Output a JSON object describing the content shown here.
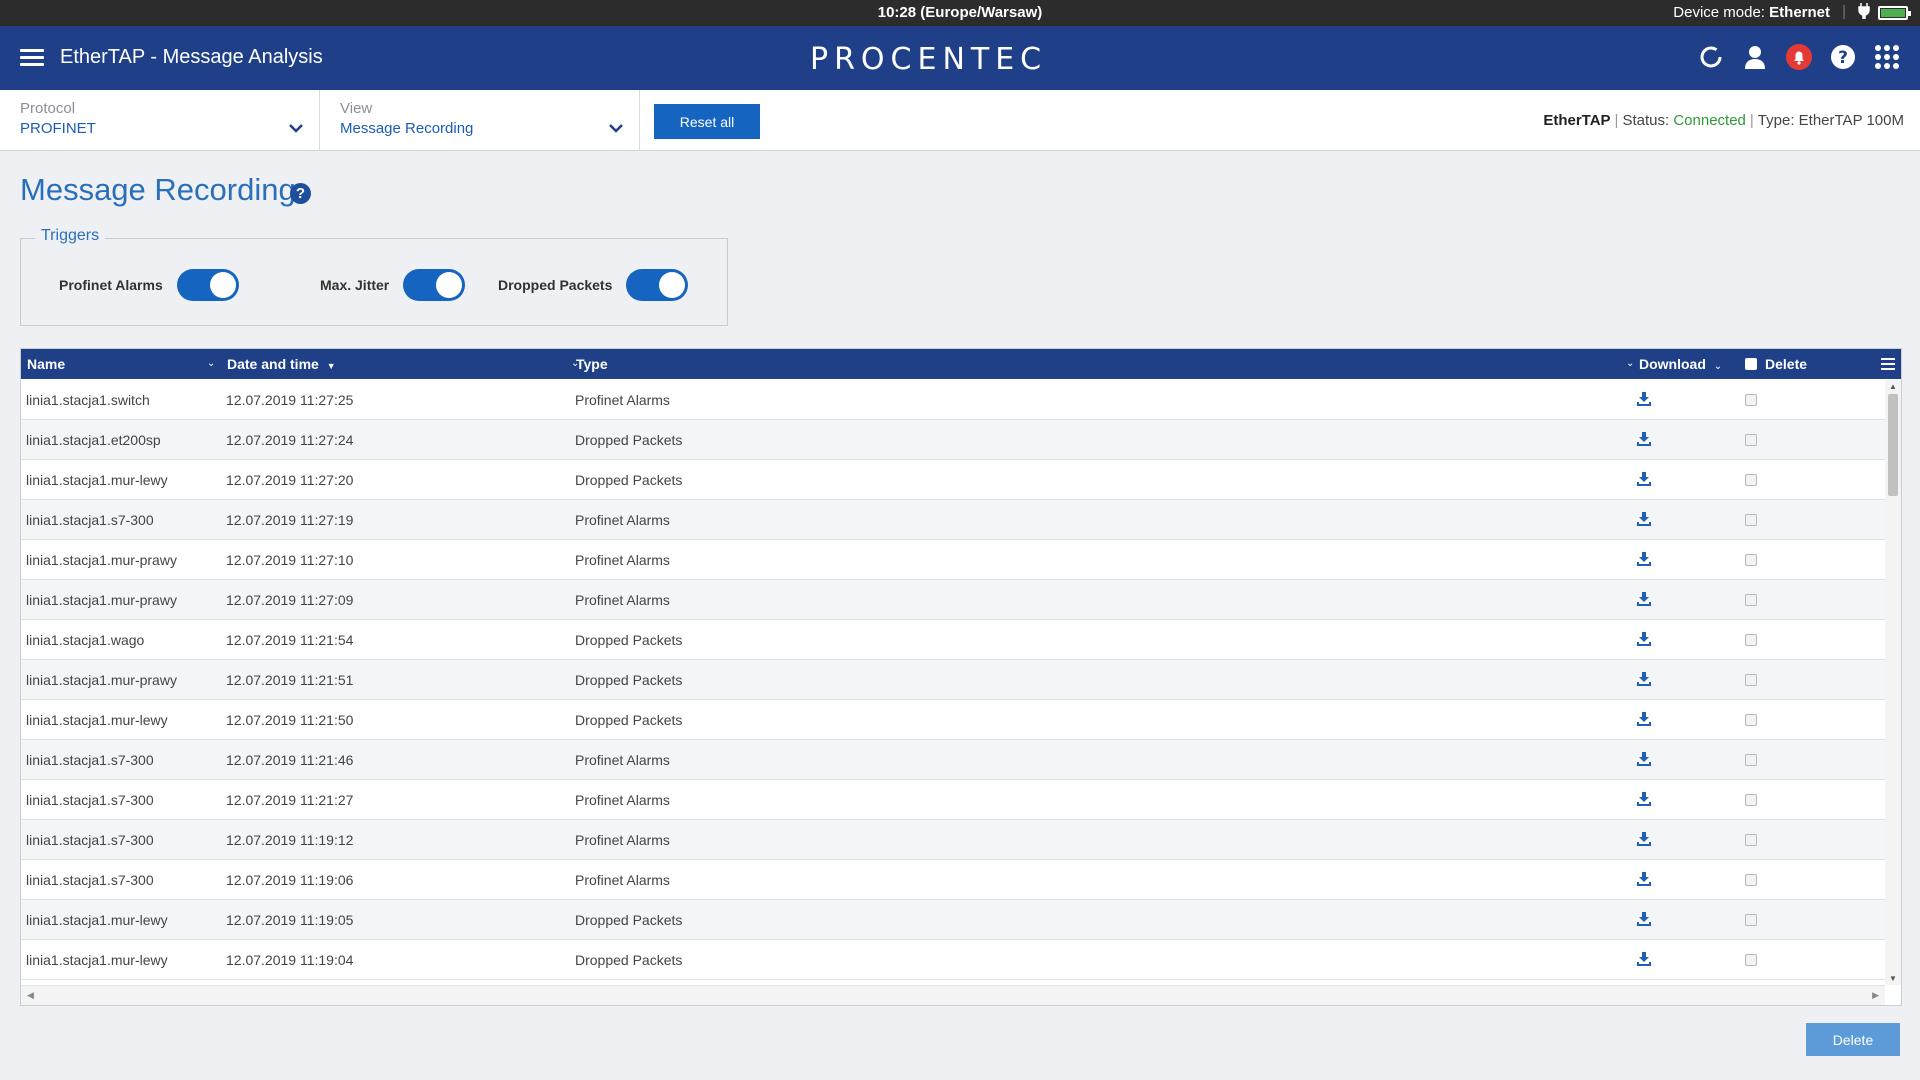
{
  "statusbar": {
    "clock": "10:28 (Europe/Warsaw)",
    "mode_label": "Device mode:",
    "mode_value": "Ethernet",
    "separator": "|"
  },
  "header": {
    "title": "EtherTAP - Message Analysis",
    "logo": "PROCENTEC",
    "icons": [
      "refresh-icon",
      "user-icon",
      "notifications-icon",
      "help-icon",
      "apps-icon"
    ],
    "alert_color": "#e53935"
  },
  "toolbar": {
    "protocol_label": "Protocol",
    "protocol_value": "PROFINET",
    "view_label": "View",
    "view_value": "Message Recording",
    "reset_label": "Reset all",
    "device_name": "EtherTAP",
    "status_label": "Status:",
    "status_value": "Connected",
    "type_label": "Type:",
    "type_value": "EtherTAP 100M",
    "separator": "|"
  },
  "page": {
    "title": "Message Recording",
    "help_glyph": "?"
  },
  "triggers": {
    "legend": "Triggers",
    "items": [
      {
        "label": "Profinet Alarms",
        "on": true
      },
      {
        "label": "Max. Jitter",
        "on": true
      },
      {
        "label": "Dropped Packets",
        "on": true
      }
    ]
  },
  "table": {
    "columns": {
      "name": "Name",
      "datetime": "Date and time",
      "type": "Type",
      "download": "Download",
      "delete": "Delete"
    },
    "rows": [
      {
        "name": "linia1.stacja1.switch",
        "datetime": "12.07.2019 11:27:25",
        "type": "Profinet Alarms"
      },
      {
        "name": "linia1.stacja1.et200sp",
        "datetime": "12.07.2019 11:27:24",
        "type": "Dropped Packets"
      },
      {
        "name": "linia1.stacja1.mur-lewy",
        "datetime": "12.07.2019 11:27:20",
        "type": "Dropped Packets"
      },
      {
        "name": "linia1.stacja1.s7-300",
        "datetime": "12.07.2019 11:27:19",
        "type": "Profinet Alarms"
      },
      {
        "name": "linia1.stacja1.mur-prawy",
        "datetime": "12.07.2019 11:27:10",
        "type": "Profinet Alarms"
      },
      {
        "name": "linia1.stacja1.mur-prawy",
        "datetime": "12.07.2019 11:27:09",
        "type": "Profinet Alarms"
      },
      {
        "name": "linia1.stacja1.wago",
        "datetime": "12.07.2019 11:21:54",
        "type": "Dropped Packets"
      },
      {
        "name": "linia1.stacja1.mur-prawy",
        "datetime": "12.07.2019 11:21:51",
        "type": "Dropped Packets"
      },
      {
        "name": "linia1.stacja1.mur-lewy",
        "datetime": "12.07.2019 11:21:50",
        "type": "Dropped Packets"
      },
      {
        "name": "linia1.stacja1.s7-300",
        "datetime": "12.07.2019 11:21:46",
        "type": "Profinet Alarms"
      },
      {
        "name": "linia1.stacja1.s7-300",
        "datetime": "12.07.2019 11:21:27",
        "type": "Profinet Alarms"
      },
      {
        "name": "linia1.stacja1.s7-300",
        "datetime": "12.07.2019 11:19:12",
        "type": "Profinet Alarms"
      },
      {
        "name": "linia1.stacja1.s7-300",
        "datetime": "12.07.2019 11:19:06",
        "type": "Profinet Alarms"
      },
      {
        "name": "linia1.stacja1.mur-lewy",
        "datetime": "12.07.2019 11:19:05",
        "type": "Dropped Packets"
      },
      {
        "name": "linia1.stacja1.mur-lewy",
        "datetime": "12.07.2019 11:19:04",
        "type": "Dropped Packets"
      }
    ]
  },
  "footer": {
    "delete_label": "Delete"
  },
  "colors": {
    "header_bg": "#1f4088",
    "accent": "#1565c0",
    "connected": "#2e9a3a"
  }
}
